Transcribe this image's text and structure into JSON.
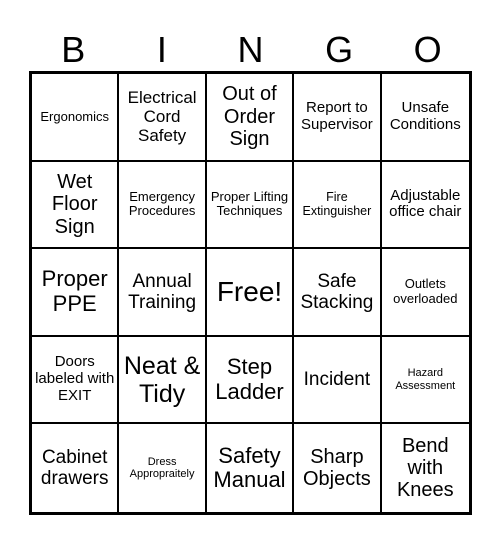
{
  "header": [
    "B",
    "I",
    "N",
    "G",
    "O"
  ],
  "cells": [
    "Ergonomics",
    "Electrical Cord Safety",
    "Out of Order Sign",
    "Report to Supervisor",
    "Unsafe Conditions",
    "Wet Floor Sign",
    "Emergency Procedures",
    "Proper Lifting Techniques",
    "Fire Extinguisher",
    "Adjustable office chair",
    "Proper PPE",
    "Annual Training",
    "Free!",
    "Safe Stacking",
    "Outlets overloaded",
    "Doors labeled with EXIT",
    "Neat & Tidy",
    "Step Ladder",
    "Incident",
    "Hazard Assessment",
    "Cabinet drawers",
    "Dress Appropraitely",
    "Safety Manual",
    "Sharp Objects",
    "Bend with Knees"
  ]
}
